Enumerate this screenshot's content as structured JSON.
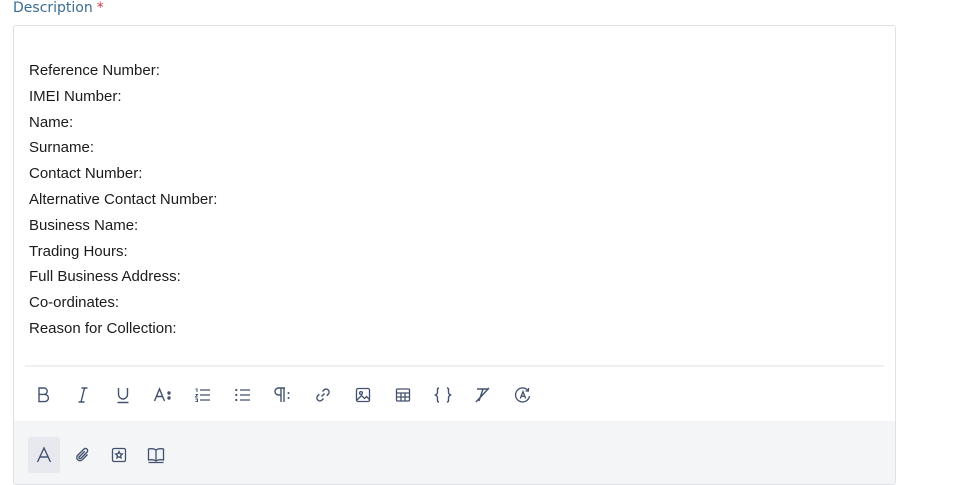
{
  "field": {
    "label": "Description",
    "required_marker": "*"
  },
  "editor": {
    "lines": [
      "Reference Number:",
      "IMEI Number:",
      "Name:",
      "Surname:",
      "Contact Number:",
      "Alternative Contact Number:",
      "Business Name:",
      "Trading Hours:",
      "Full Business Address:",
      "Co-ordinates:",
      "Reason for Collection:"
    ]
  },
  "toolbar": {
    "icons": [
      "bold-icon",
      "italic-icon",
      "underline-icon",
      "font-size-icon",
      "numbered-list-icon",
      "bullet-list-icon",
      "paragraph-icon",
      "link-icon",
      "image-icon",
      "table-icon",
      "code-block-icon",
      "clear-format-icon",
      "autocorrect-icon"
    ]
  },
  "footer": {
    "icons": [
      "text-mode-icon",
      "attachment-icon",
      "snippet-icon",
      "knowledge-base-icon"
    ],
    "active": "text-mode-icon"
  },
  "colors": {
    "label": "#3a6e94",
    "required": "#d0384a",
    "icon": "#42526e",
    "footer_bg": "#f4f5f7",
    "border": "#dfe1e6"
  }
}
